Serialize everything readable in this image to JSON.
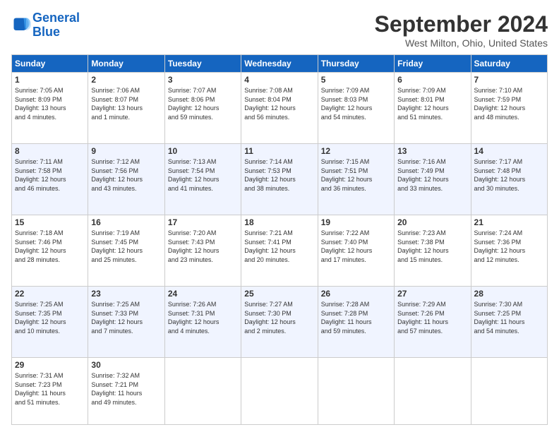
{
  "logo": {
    "line1": "General",
    "line2": "Blue"
  },
  "title": "September 2024",
  "location": "West Milton, Ohio, United States",
  "days_of_week": [
    "Sunday",
    "Monday",
    "Tuesday",
    "Wednesday",
    "Thursday",
    "Friday",
    "Saturday"
  ],
  "weeks": [
    [
      {
        "day": "1",
        "info": "Sunrise: 7:05 AM\nSunset: 8:09 PM\nDaylight: 13 hours\nand 4 minutes."
      },
      {
        "day": "2",
        "info": "Sunrise: 7:06 AM\nSunset: 8:07 PM\nDaylight: 13 hours\nand 1 minute."
      },
      {
        "day": "3",
        "info": "Sunrise: 7:07 AM\nSunset: 8:06 PM\nDaylight: 12 hours\nand 59 minutes."
      },
      {
        "day": "4",
        "info": "Sunrise: 7:08 AM\nSunset: 8:04 PM\nDaylight: 12 hours\nand 56 minutes."
      },
      {
        "day": "5",
        "info": "Sunrise: 7:09 AM\nSunset: 8:03 PM\nDaylight: 12 hours\nand 54 minutes."
      },
      {
        "day": "6",
        "info": "Sunrise: 7:09 AM\nSunset: 8:01 PM\nDaylight: 12 hours\nand 51 minutes."
      },
      {
        "day": "7",
        "info": "Sunrise: 7:10 AM\nSunset: 7:59 PM\nDaylight: 12 hours\nand 48 minutes."
      }
    ],
    [
      {
        "day": "8",
        "info": "Sunrise: 7:11 AM\nSunset: 7:58 PM\nDaylight: 12 hours\nand 46 minutes."
      },
      {
        "day": "9",
        "info": "Sunrise: 7:12 AM\nSunset: 7:56 PM\nDaylight: 12 hours\nand 43 minutes."
      },
      {
        "day": "10",
        "info": "Sunrise: 7:13 AM\nSunset: 7:54 PM\nDaylight: 12 hours\nand 41 minutes."
      },
      {
        "day": "11",
        "info": "Sunrise: 7:14 AM\nSunset: 7:53 PM\nDaylight: 12 hours\nand 38 minutes."
      },
      {
        "day": "12",
        "info": "Sunrise: 7:15 AM\nSunset: 7:51 PM\nDaylight: 12 hours\nand 36 minutes."
      },
      {
        "day": "13",
        "info": "Sunrise: 7:16 AM\nSunset: 7:49 PM\nDaylight: 12 hours\nand 33 minutes."
      },
      {
        "day": "14",
        "info": "Sunrise: 7:17 AM\nSunset: 7:48 PM\nDaylight: 12 hours\nand 30 minutes."
      }
    ],
    [
      {
        "day": "15",
        "info": "Sunrise: 7:18 AM\nSunset: 7:46 PM\nDaylight: 12 hours\nand 28 minutes."
      },
      {
        "day": "16",
        "info": "Sunrise: 7:19 AM\nSunset: 7:45 PM\nDaylight: 12 hours\nand 25 minutes."
      },
      {
        "day": "17",
        "info": "Sunrise: 7:20 AM\nSunset: 7:43 PM\nDaylight: 12 hours\nand 23 minutes."
      },
      {
        "day": "18",
        "info": "Sunrise: 7:21 AM\nSunset: 7:41 PM\nDaylight: 12 hours\nand 20 minutes."
      },
      {
        "day": "19",
        "info": "Sunrise: 7:22 AM\nSunset: 7:40 PM\nDaylight: 12 hours\nand 17 minutes."
      },
      {
        "day": "20",
        "info": "Sunrise: 7:23 AM\nSunset: 7:38 PM\nDaylight: 12 hours\nand 15 minutes."
      },
      {
        "day": "21",
        "info": "Sunrise: 7:24 AM\nSunset: 7:36 PM\nDaylight: 12 hours\nand 12 minutes."
      }
    ],
    [
      {
        "day": "22",
        "info": "Sunrise: 7:25 AM\nSunset: 7:35 PM\nDaylight: 12 hours\nand 10 minutes."
      },
      {
        "day": "23",
        "info": "Sunrise: 7:25 AM\nSunset: 7:33 PM\nDaylight: 12 hours\nand 7 minutes."
      },
      {
        "day": "24",
        "info": "Sunrise: 7:26 AM\nSunset: 7:31 PM\nDaylight: 12 hours\nand 4 minutes."
      },
      {
        "day": "25",
        "info": "Sunrise: 7:27 AM\nSunset: 7:30 PM\nDaylight: 12 hours\nand 2 minutes."
      },
      {
        "day": "26",
        "info": "Sunrise: 7:28 AM\nSunset: 7:28 PM\nDaylight: 11 hours\nand 59 minutes."
      },
      {
        "day": "27",
        "info": "Sunrise: 7:29 AM\nSunset: 7:26 PM\nDaylight: 11 hours\nand 57 minutes."
      },
      {
        "day": "28",
        "info": "Sunrise: 7:30 AM\nSunset: 7:25 PM\nDaylight: 11 hours\nand 54 minutes."
      }
    ],
    [
      {
        "day": "29",
        "info": "Sunrise: 7:31 AM\nSunset: 7:23 PM\nDaylight: 11 hours\nand 51 minutes."
      },
      {
        "day": "30",
        "info": "Sunrise: 7:32 AM\nSunset: 7:21 PM\nDaylight: 11 hours\nand 49 minutes."
      },
      {
        "day": "",
        "info": ""
      },
      {
        "day": "",
        "info": ""
      },
      {
        "day": "",
        "info": ""
      },
      {
        "day": "",
        "info": ""
      },
      {
        "day": "",
        "info": ""
      }
    ]
  ]
}
